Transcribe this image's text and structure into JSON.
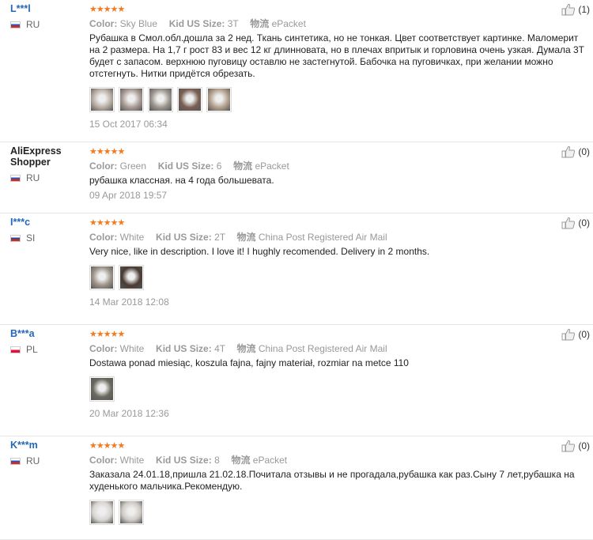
{
  "labels": {
    "color": "Color:",
    "size": "Kid US Size:",
    "shipping": "物流"
  },
  "stars_text": "★★★★★",
  "reviews": [
    {
      "name": "L***l",
      "country": "RU",
      "flag": "ru",
      "color": "Sky Blue",
      "size": "3T",
      "shipping": "ePacket",
      "text": "Рубашка в Смол.обл.дошла за 2 нед. Ткань синтетика, но не тонкая. Цвет соответствует картинке. Маломерит на 2 размера. На 1,7 г рост 83 и вес 12 кг длинновата, но в плечах впритык и горловина очень узкая. Думала 3Т будет с запасом. верхнюю пуговицу оставлю не застегнутой. Бабочка на пуговичках, при желании можно отстегнуть. Нитки придётся обрезать.",
      "date": "15 Oct 2017 06:34",
      "helpful": "(1)",
      "photos": [
        "#b9aea4",
        "#a99a94",
        "#9c958e",
        "#7a5f52",
        "#b4a08e"
      ]
    },
    {
      "name": "AliExpress Shopper",
      "country": "RU",
      "flag": "ru",
      "color": "Green",
      "size": "6",
      "shipping": "ePacket",
      "text": "рубашка классная. на 4 года большевата.",
      "date": "09 Apr 2018 19:57",
      "helpful": "(0)",
      "photos": []
    },
    {
      "name": "I***c",
      "country": "SI",
      "flag": "si",
      "color": "White",
      "size": "2T",
      "shipping": "China Post Registered Air Mail",
      "text": "Very nice, like in description. I love it! I hughly recomended. Delivery in 2 months.",
      "date": "14 Mar 2018 12:08",
      "helpful": "(0)",
      "photos": [
        "#9d9389",
        "#4a3b33"
      ]
    },
    {
      "name": "B***a",
      "country": "PL",
      "flag": "pl",
      "color": "White",
      "size": "4T",
      "shipping": "China Post Registered Air Mail",
      "text": "Dostawa ponad miesiąc, koszula fajna, fajny materiał, rozmiar na metce 110",
      "date": "20 Mar 2018 12:36",
      "helpful": "(0)",
      "photos": [
        "#6b6a5f"
      ]
    },
    {
      "name": "K***m",
      "country": "RU",
      "flag": "ru",
      "color": "White",
      "size": "8",
      "shipping": "ePacket",
      "text": "Заказала 24.01.18,пришла 21.02.18.Почитала отзывы и не прогадала,рубашка как раз.Сыну 7 лет,рубашка на худенького мальчика.Рекомендую.",
      "date": "",
      "helpful": "(0)",
      "photos": [
        "#d9d6d2",
        "#cfcac4"
      ]
    }
  ],
  "colors": {
    "name_link": "#2567b8",
    "star": "#f47a1f",
    "muted": "#999999"
  }
}
